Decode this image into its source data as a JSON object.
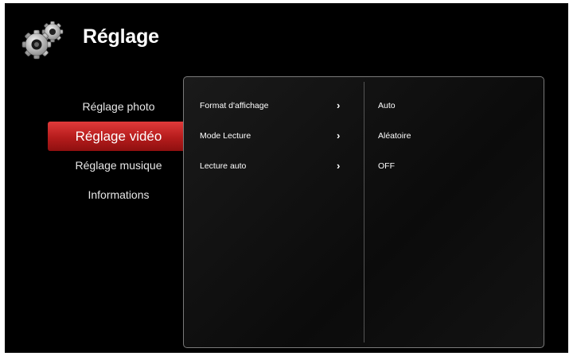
{
  "header": {
    "title": "Réglage",
    "icon": "gears-icon"
  },
  "menu": {
    "items": [
      {
        "label": "Réglage photo",
        "active": false
      },
      {
        "label": "Réglage vidéo",
        "active": true
      },
      {
        "label": "Réglage musique",
        "active": false
      },
      {
        "label": "Informations",
        "active": false
      }
    ]
  },
  "settings": {
    "rows": [
      {
        "label": "Format d'affichage",
        "value": "Auto",
        "chevron": "›"
      },
      {
        "label": "Mode Lecture",
        "value": "Aléatoire",
        "chevron": "›"
      },
      {
        "label": "Lecture auto",
        "value": "OFF",
        "chevron": "›"
      }
    ]
  },
  "colors": {
    "accent": "#c02020",
    "background": "#000000",
    "text": "#ffffff"
  }
}
